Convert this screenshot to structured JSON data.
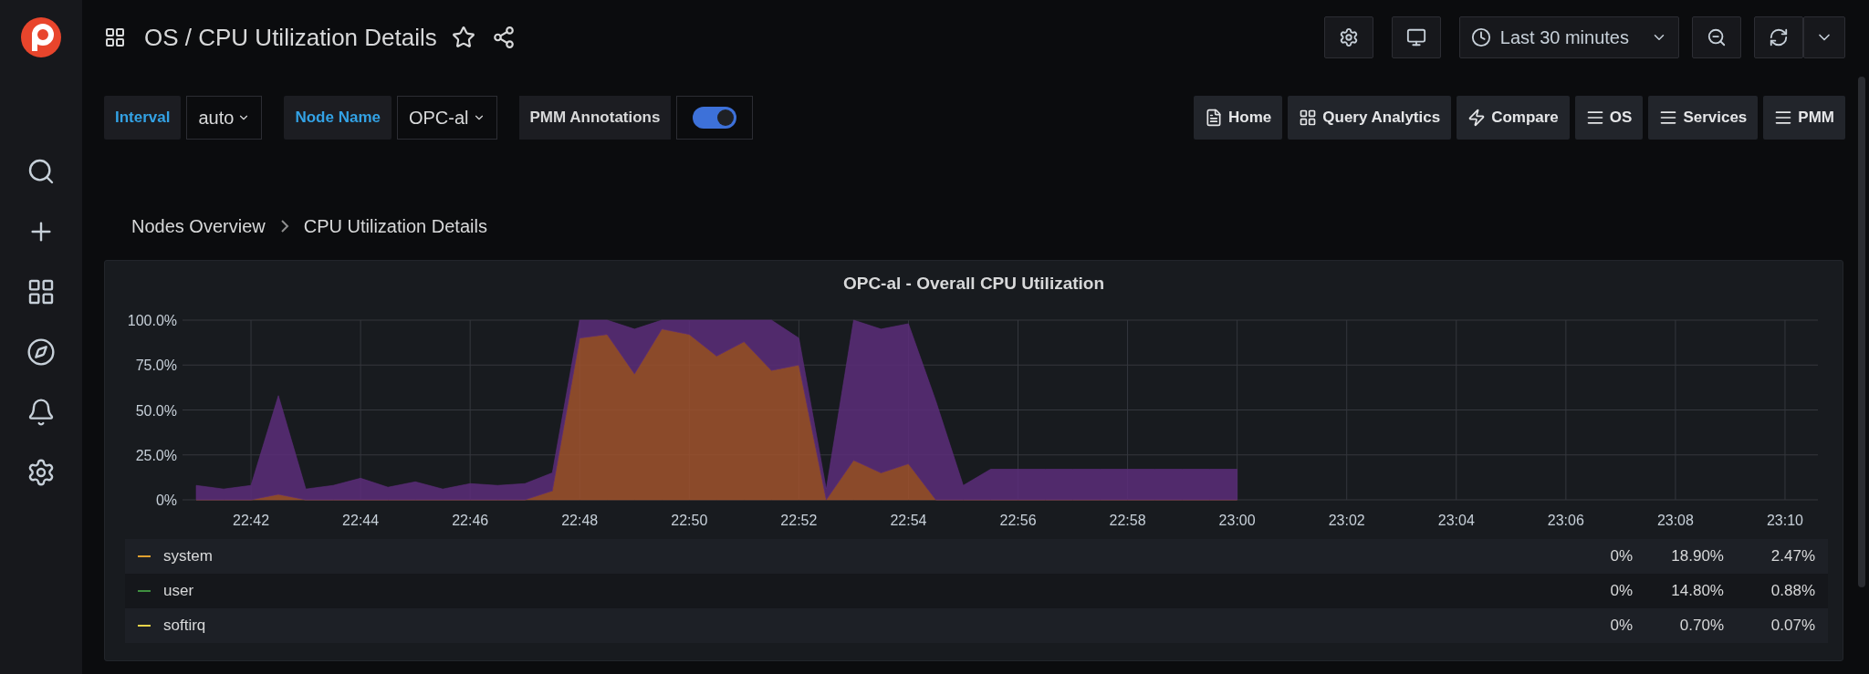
{
  "sidebar": {
    "items": [
      {
        "kind": "search",
        "selected": false
      },
      {
        "kind": "create",
        "selected": false
      },
      {
        "kind": "dashboards",
        "selected": false
      },
      {
        "kind": "explore",
        "selected": false
      },
      {
        "kind": "alerting",
        "selected": false
      },
      {
        "kind": "settings",
        "selected": false
      }
    ]
  },
  "header": {
    "title": "OS / CPU Utilization Details",
    "time_range": "Last 30 minutes"
  },
  "variables": [
    {
      "label": "Interval",
      "value": "auto"
    },
    {
      "label": "Node Name",
      "value": "OPC-al"
    }
  ],
  "annotations_toggle": {
    "label": "PMM Annotations",
    "on": true
  },
  "links": [
    {
      "kind": "doc",
      "label": "Home"
    },
    {
      "kind": "grid",
      "label": "Query Analytics"
    },
    {
      "kind": "bolt",
      "label": "Compare"
    },
    {
      "kind": "menu",
      "label": "OS"
    },
    {
      "kind": "menu",
      "label": "Services"
    },
    {
      "kind": "menu",
      "label": "PMM"
    }
  ],
  "breadcrumb": [
    "Nodes Overview",
    "CPU Utilization Details"
  ],
  "panel": {
    "title": "OPC-al - Overall CPU Utilization",
    "chart_data": {
      "type": "area",
      "stacked": true,
      "grid": true,
      "ylim": [
        0,
        100
      ],
      "yticks": [
        {
          "value": 0,
          "label": "0%"
        },
        {
          "value": 25,
          "label": "25.0%"
        },
        {
          "value": 50,
          "label": "50.0%"
        },
        {
          "value": 75,
          "label": "75.0%"
        },
        {
          "value": 100,
          "label": "100.0%"
        }
      ],
      "categories": [
        null,
        null,
        "22:42",
        null,
        null,
        null,
        "22:44",
        null,
        null,
        null,
        "22:46",
        null,
        null,
        null,
        "22:48",
        null,
        null,
        null,
        "22:50",
        null,
        null,
        null,
        "22:52",
        null,
        null,
        null,
        "22:54",
        null,
        null,
        null,
        "22:56",
        null,
        null,
        null,
        "22:58",
        null,
        null,
        null,
        "23:00",
        null,
        null,
        null,
        "23:02",
        null,
        null,
        null,
        "23:04",
        null,
        null,
        null,
        "23:06",
        null,
        null,
        null,
        "23:08",
        null,
        null,
        null,
        "23:10",
        null
      ],
      "series": [
        {
          "color": "#a0522d",
          "values": [
            0,
            0,
            0,
            3,
            0,
            0,
            0,
            0,
            0,
            0,
            0,
            0,
            0,
            5,
            90,
            92,
            70,
            95,
            92,
            80,
            88,
            72,
            75,
            0,
            22,
            15,
            20,
            0,
            0,
            0,
            0,
            0,
            0,
            0,
            0,
            0,
            0,
            0,
            0,
            null,
            null,
            null,
            null,
            null,
            null,
            null,
            null,
            null,
            null,
            null,
            null,
            null,
            null,
            null,
            null,
            null,
            null,
            null,
            null,
            null
          ]
        },
        {
          "color": "#5c2d7a",
          "values": [
            8,
            6,
            8,
            55,
            6,
            8,
            12,
            7,
            10,
            6,
            9,
            8,
            9,
            10,
            10,
            8,
            25,
            5,
            8,
            20,
            12,
            28,
            15,
            6,
            78,
            80,
            78,
            55,
            8,
            17,
            17,
            17,
            17,
            17,
            17,
            17,
            17,
            17,
            17,
            null,
            null,
            null,
            null,
            null,
            null,
            null,
            null,
            null,
            null,
            null,
            null,
            null,
            null,
            null,
            null,
            null,
            null,
            null,
            null,
            null
          ]
        }
      ]
    },
    "legend": [
      {
        "name": "system",
        "color": "#e0a030",
        "values": [
          "0%",
          "18.90%",
          "2.47%"
        ]
      },
      {
        "name": "user",
        "color": "#3f8f3f",
        "values": [
          "0%",
          "14.80%",
          "0.88%"
        ]
      },
      {
        "name": "softirq",
        "color": "#e8d44a",
        "values": [
          "0%",
          "0.70%",
          "0.07%"
        ]
      }
    ]
  }
}
